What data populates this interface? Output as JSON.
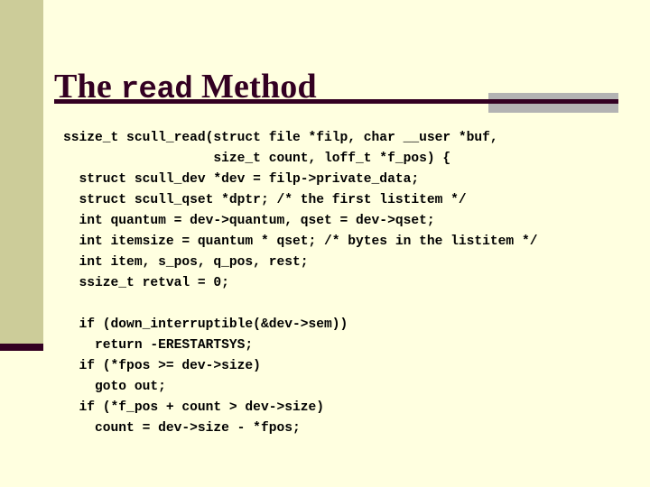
{
  "slide": {
    "title": {
      "prefix": "The ",
      "mono_word": "read",
      "suffix": " Method"
    },
    "colors": {
      "background": "#ffffe0",
      "accent_band": "#cccc99",
      "title_text": "#330022",
      "rule": "#330022",
      "rule_accent_block": "#b3b3b3",
      "code_text": "#000000"
    },
    "code": {
      "language": "c",
      "lines": [
        "ssize_t scull_read(struct file *filp, char __user *buf,",
        "                   size_t count, loff_t *f_pos) {",
        "  struct scull_dev *dev = filp->private_data;",
        "  struct scull_qset *dptr; /* the first listitem */",
        "  int quantum = dev->quantum, qset = dev->qset;",
        "  int itemsize = quantum * qset; /* bytes in the listitem */",
        "  int item, s_pos, q_pos, rest;",
        "  ssize_t retval = 0;",
        "",
        "  if (down_interruptible(&dev->sem))",
        "    return -ERESTARTSYS;",
        "  if (*fpos >= dev->size)",
        "    goto out;",
        "  if (*f_pos + count > dev->size)",
        "    count = dev->size - *fpos;"
      ]
    }
  }
}
